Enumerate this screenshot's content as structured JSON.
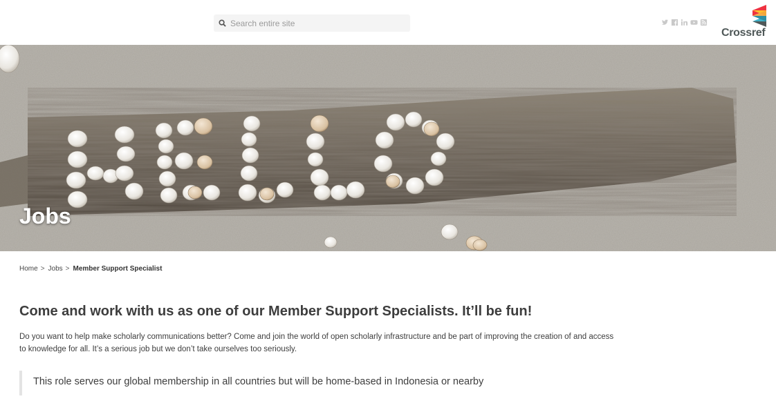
{
  "header": {
    "search": {
      "placeholder": "Search entire site",
      "icon": "search-icon"
    },
    "social": [
      "twitter-icon",
      "facebook-icon",
      "linkedin-icon",
      "youtube-icon",
      "rss-icon"
    ],
    "logo": {
      "wordmark": "Crossref",
      "colors": [
        "#ef3340",
        "#ffc72c",
        "#3eb1c8",
        "#4f5858"
      ]
    }
  },
  "hero": {
    "title": "Jobs"
  },
  "breadcrumb": {
    "home": "Home",
    "sep": ">",
    "jobs": "Jobs",
    "current": "Member Support Specialist"
  },
  "content": {
    "lead_prefix": "Come and work with us as one of our ",
    "lead_strong": "Member Support Specialists",
    "lead_suffix": ". It’ll be fun!",
    "intro": "Do you want to help make scholarly communications better? Come and join the world of open scholarly infrastructure and be part of improving the creation of and access to knowledge for all. It’s a serious job but we don’t take ourselves too seriously.",
    "quote": "This role serves our global membership in all countries but will be home-based in Indonesia or nearby"
  }
}
